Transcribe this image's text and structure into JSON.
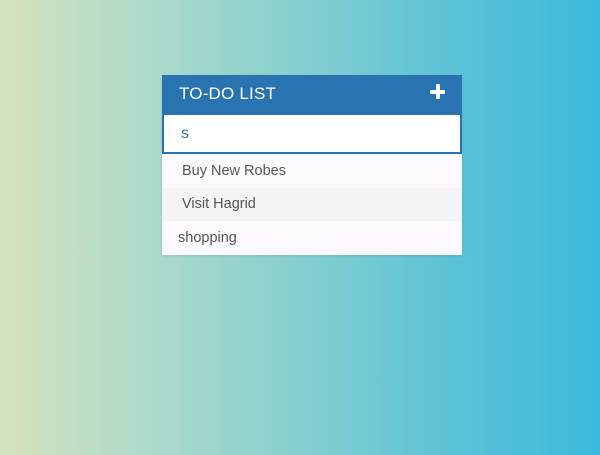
{
  "header": {
    "title": "TO-DO LIST",
    "add_icon": "plus-icon"
  },
  "input": {
    "value": "s",
    "placeholder": ""
  },
  "todos": [
    {
      "text": "Buy New Robes"
    },
    {
      "text": "Visit Hagrid"
    },
    {
      "text": "shopping"
    }
  ],
  "colors": {
    "header_bg": "#2a73b1",
    "accent": "#2a73b1",
    "row_alt": "#f4f3f6",
    "background_gradient": [
      "#d5e1bd",
      "#39badb"
    ]
  }
}
